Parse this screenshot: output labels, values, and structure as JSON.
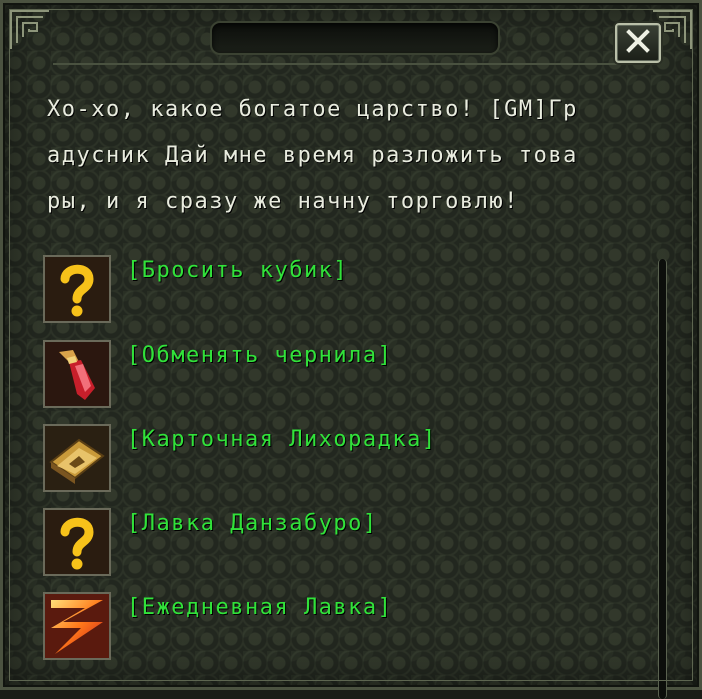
{
  "dialog": {
    "title": "",
    "close_icon": "close-x-icon",
    "message": "Хо-хо, какое богатое царство! [GM]Гр\nадусник Дай мне время разложить това\nры, и я сразу же начну торговлю!"
  },
  "options": [
    {
      "label": "[Бросить кубик]",
      "icon": "question-mark-icon"
    },
    {
      "label": "[Обменять чернила]",
      "icon": "red-ink-crystal-icon"
    },
    {
      "label": "[Карточная Лихорадка]",
      "icon": "golden-card-icon"
    },
    {
      "label": "[Лавка Данзабуро]",
      "icon": "question-mark-icon"
    },
    {
      "label": "[Ежедневная Лавка]",
      "icon": "lightning-icon"
    }
  ],
  "colors": {
    "option_text": "#31e23a",
    "message_text": "#e9ecdf",
    "panel_background": "#22271f"
  }
}
